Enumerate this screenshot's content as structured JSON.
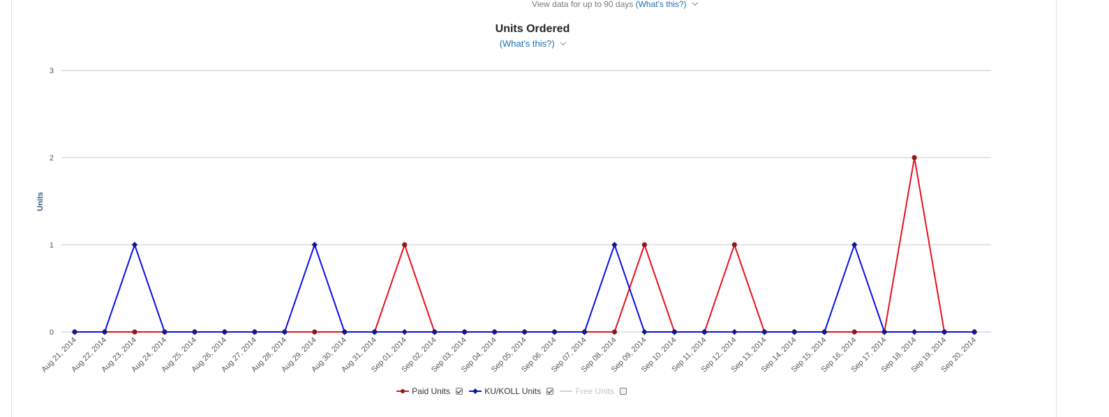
{
  "header": {
    "note_text": "View data for up to 90 days",
    "note_link": "(What's this?)"
  },
  "chart_title": {
    "title": "Units Ordered",
    "subtitle_link": "(What's this?)"
  },
  "colors": {
    "paid": "#e8101f",
    "paid_marker": "#8b1a1a",
    "ku": "#0a10e8",
    "ku_marker": "#0d1a8c",
    "free": "#d0d0d0",
    "grid": "#c8c8c8",
    "axis_label": "#3a5a80"
  },
  "legend": [
    {
      "label": "Paid Units",
      "checked": true,
      "enabled": true
    },
    {
      "label": "KU/KOLL Units",
      "checked": true,
      "enabled": true
    },
    {
      "label": "Free Units",
      "checked": false,
      "enabled": false
    }
  ],
  "chart_data": {
    "type": "line",
    "title": "Units Ordered",
    "xlabel": "",
    "ylabel": "Units",
    "ylim": [
      0,
      3
    ],
    "yticks": [
      0,
      1,
      2,
      3
    ],
    "grid": true,
    "legend_position": "bottom",
    "categories": [
      "Aug 21, 2014",
      "Aug 22, 2014",
      "Aug 23, 2014",
      "Aug 24, 2014",
      "Aug 25, 2014",
      "Aug 26, 2014",
      "Aug 27, 2014",
      "Aug 28, 2014",
      "Aug 29, 2014",
      "Aug 30, 2014",
      "Aug 31, 2014",
      "Sep 01, 2014",
      "Sep 02, 2014",
      "Sep 03, 2014",
      "Sep 04, 2014",
      "Sep 05, 2014",
      "Sep 06, 2014",
      "Sep 07, 2014",
      "Sep 08, 2014",
      "Sep 09, 2014",
      "Sep 10, 2014",
      "Sep 11, 2014",
      "Sep 12, 2014",
      "Sep 13, 2014",
      "Sep 14, 2014",
      "Sep 15, 2014",
      "Sep 16, 2014",
      "Sep 17, 2014",
      "Sep 18, 2014",
      "Sep 19, 2014",
      "Sep 20, 2014"
    ],
    "series": [
      {
        "name": "Paid Units",
        "values": [
          0,
          0,
          0,
          0,
          0,
          0,
          0,
          0,
          0,
          0,
          0,
          1,
          0,
          0,
          0,
          0,
          0,
          0,
          0,
          1,
          0,
          0,
          1,
          0,
          0,
          0,
          0,
          0,
          2,
          0,
          0
        ]
      },
      {
        "name": "KU/KOLL Units",
        "values": [
          0,
          0,
          1,
          0,
          0,
          0,
          0,
          0,
          1,
          0,
          0,
          0,
          0,
          0,
          0,
          0,
          0,
          0,
          1,
          0,
          0,
          0,
          0,
          0,
          0,
          0,
          1,
          0,
          0,
          0,
          0
        ]
      }
    ]
  }
}
